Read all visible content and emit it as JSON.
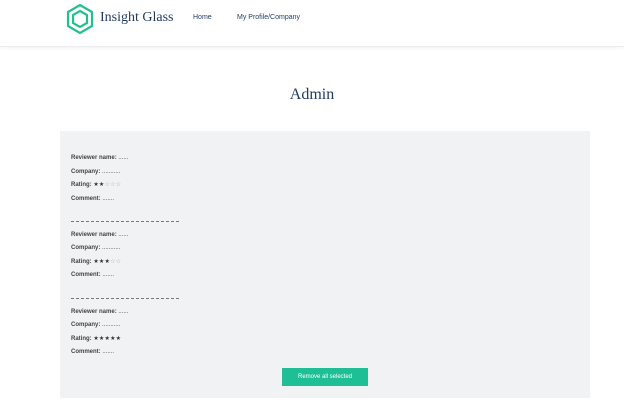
{
  "header": {
    "brand": "Insight Glass",
    "nav": [
      {
        "label": "Home"
      },
      {
        "label": "My Profile/Company"
      }
    ]
  },
  "page": {
    "title": "Admin"
  },
  "reviews": [
    {
      "name_label": "Reviewer name:",
      "name": "......",
      "company_label": "Company:",
      "company": "...........",
      "rating_label": "Rating:",
      "rating_value": 2,
      "rating_max": 5,
      "comment_label": "Comment:",
      "comment": "......."
    },
    {
      "name_label": "Reviewer name:",
      "name": "......",
      "company_label": "Company:",
      "company": "...........",
      "rating_label": "Rating:",
      "rating_value": 3,
      "rating_max": 5,
      "comment_label": "Comment:",
      "comment": "......."
    },
    {
      "name_label": "Reviewer name:",
      "name": "......",
      "company_label": "Company:",
      "company": "...........",
      "rating_label": "Rating:",
      "rating_value": 5,
      "rating_max": 5,
      "comment_label": "Comment:",
      "comment": "......."
    }
  ],
  "actions": {
    "remove_label": "Remove all selected"
  },
  "colors": {
    "accent": "#1fbf95",
    "brand": "#1e3a5f",
    "panel": "#f1f2f4"
  }
}
